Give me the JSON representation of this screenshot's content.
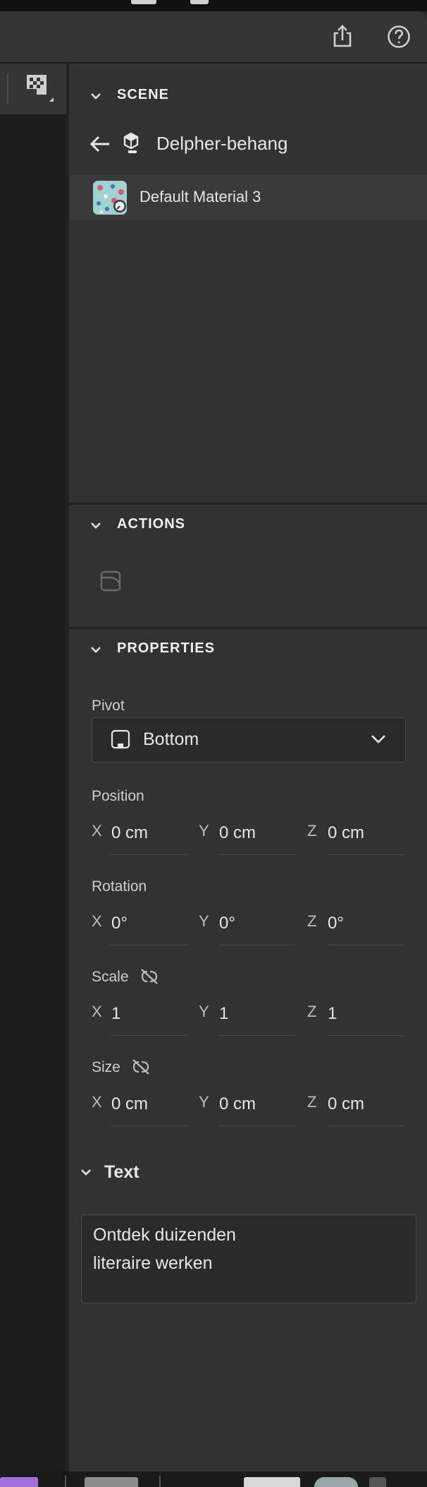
{
  "header": {
    "share_icon": "share-icon",
    "help_icon": "help-icon"
  },
  "scene": {
    "title": "SCENE",
    "model_name": "Delpher-behang",
    "material_name": "Default Material 3"
  },
  "actions": {
    "title": "ACTIONS"
  },
  "properties": {
    "title": "PROPERTIES",
    "pivot_label": "Pivot",
    "pivot_value": "Bottom",
    "position_label": "Position",
    "rotation_label": "Rotation",
    "scale_label": "Scale",
    "size_label": "Size",
    "axes": {
      "x": "X",
      "y": "Y",
      "z": "Z"
    },
    "position": {
      "x": "0 cm",
      "y": "0 cm",
      "z": "0 cm"
    },
    "rotation": {
      "x": "0°",
      "y": "0°",
      "z": "0°"
    },
    "scale": {
      "x": "1",
      "y": "1",
      "z": "1"
    },
    "size": {
      "x": "0 cm",
      "y": "0 cm",
      "z": "0 cm"
    }
  },
  "text_section": {
    "title": "Text",
    "line1": "Ontdek duizenden",
    "line2": "literaire werken"
  },
  "colors": {
    "panel_bg": "#323232",
    "canvas_bg": "#1d1d1d",
    "selected_row": "#3a3a3a"
  }
}
